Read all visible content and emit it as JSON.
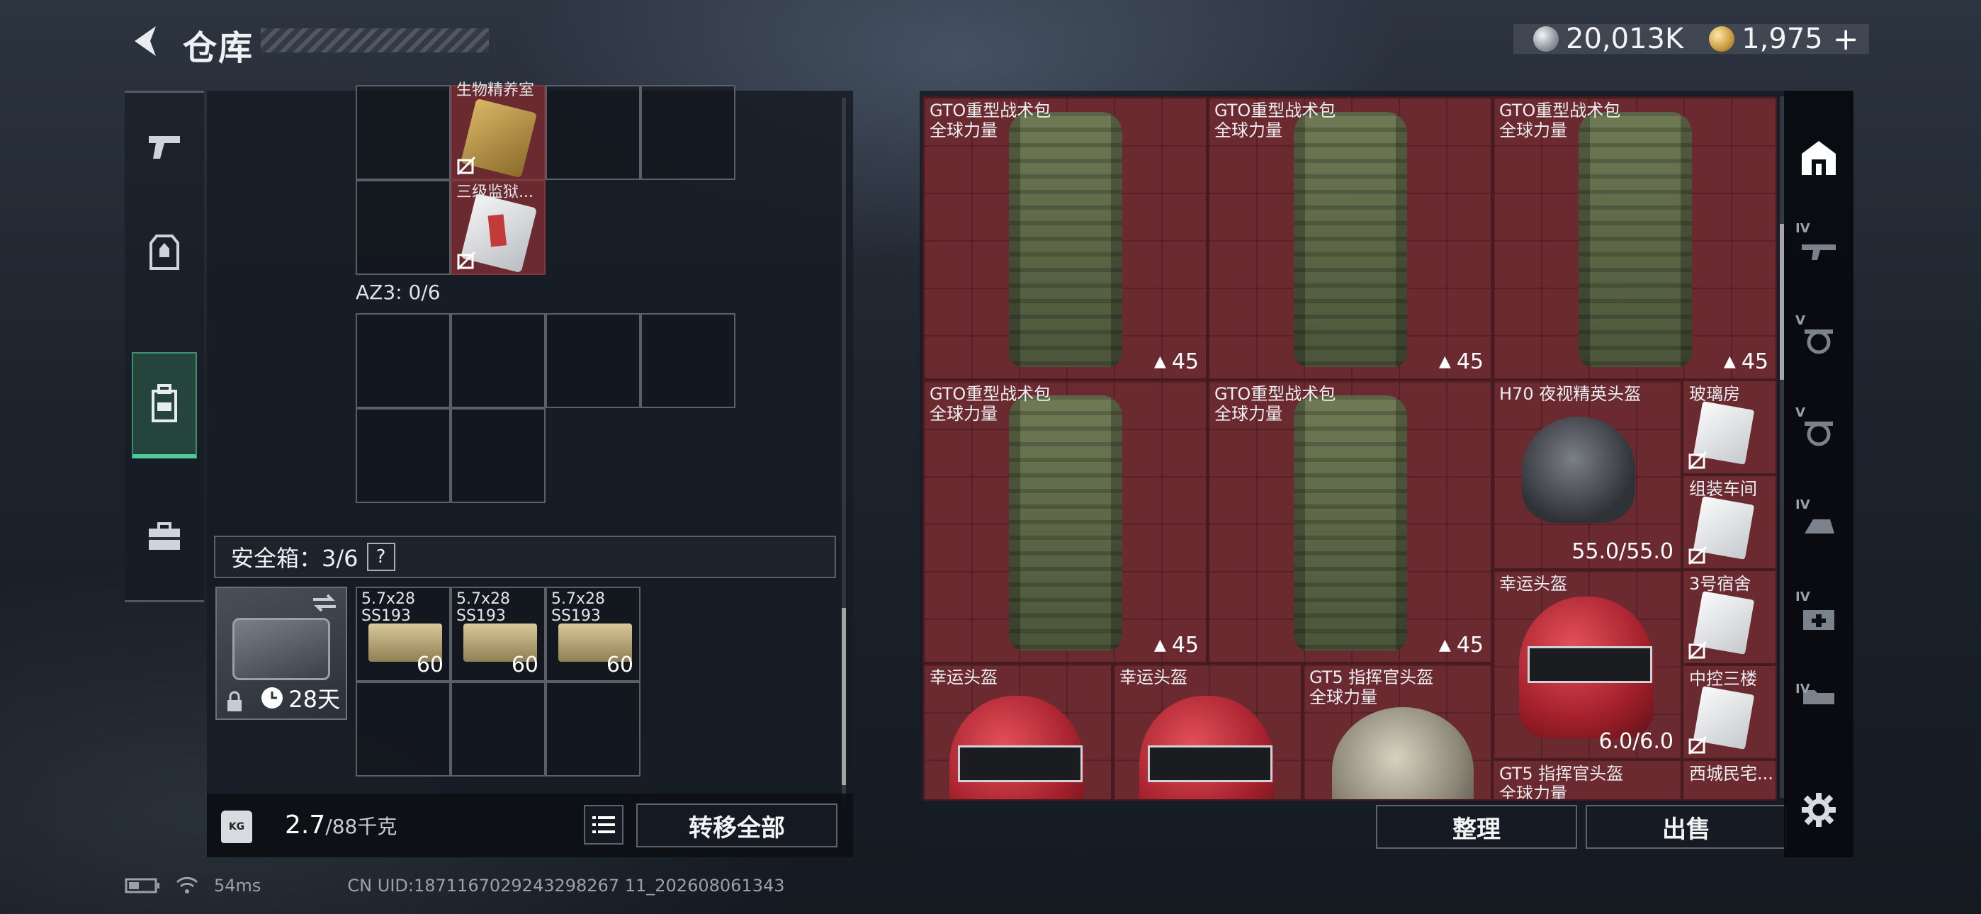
{
  "header": {
    "title": "仓库",
    "currencies": [
      {
        "icon": "silver-coin-icon",
        "value": "20,013K"
      },
      {
        "icon": "gold-coin-icon",
        "value": "1,975"
      }
    ],
    "add_currency": "+"
  },
  "left_rail": {
    "items": [
      {
        "name": "weapon",
        "icon": "pistol-icon"
      },
      {
        "name": "armor",
        "icon": "vest-icon"
      },
      {
        "name": "backpack",
        "icon": "backpack-icon",
        "active": true
      },
      {
        "name": "toolbox",
        "icon": "briefcase-icon"
      }
    ]
  },
  "stash": {
    "top_items": [
      {
        "label": "生物精养室",
        "tag": "no-trade-icon"
      },
      {
        "label": "三级监狱...",
        "tag": "no-trade-icon"
      }
    ],
    "az3_label": "AZ3: 0/6",
    "safe_label": "安全箱：3/6",
    "safe_help": "?",
    "safe_timer": "28天",
    "ammo": [
      {
        "name_line1": "5.7x28",
        "name_line2": "SS193",
        "count": "60"
      },
      {
        "name_line1": "5.7x28",
        "name_line2": "SS193",
        "count": "60"
      },
      {
        "name_line1": "5.7x28",
        "name_line2": "SS193",
        "count": "60"
      }
    ],
    "weight_value": "2.7",
    "weight_capacity": "/88千克",
    "weight_icon_text": "KG",
    "transfer_all": "转移全部"
  },
  "warehouse": {
    "backpacks": [
      {
        "name": "GTO重型战术包",
        "sub": "全球力量",
        "stat": "45"
      },
      {
        "name": "GTO重型战术包",
        "sub": "全球力量",
        "stat": "45"
      },
      {
        "name": "GTO重型战术包",
        "sub": "全球力量",
        "stat": "45"
      },
      {
        "name": "GTO重型战术包",
        "sub": "全球力量",
        "stat": "45"
      },
      {
        "name": "GTO重型战术包",
        "sub": "全球力量",
        "stat": "45"
      }
    ],
    "h70": {
      "name": "H70 夜视精英头盔",
      "stat": "55.0/55.0"
    },
    "lucky_right": {
      "name": "幸运头盔",
      "stat": "6.0/6.0"
    },
    "keys": [
      {
        "name": "玻璃房"
      },
      {
        "name": "组装车间"
      },
      {
        "name": "3号宿舍"
      },
      {
        "name": "中控三楼"
      },
      {
        "name": "西城民宅..."
      }
    ],
    "bottom_row": [
      {
        "name": "幸运头盔",
        "sub": ""
      },
      {
        "name": "幸运头盔",
        "sub": ""
      },
      {
        "name": "GT5 指挥官头盔",
        "sub": "全球力量"
      }
    ],
    "gt5_right": {
      "name": "GT5 指挥官头盔",
      "sub": "全球力量"
    },
    "sort_button": "整理",
    "sell_button": "出售"
  },
  "right_rail": {
    "levels": [
      "IV",
      "V",
      "V",
      "IV",
      "IV",
      "IV"
    ]
  },
  "footer": {
    "ping": "54ms",
    "uid": "CN UID:1871167029243298267 11_202608061343"
  }
}
